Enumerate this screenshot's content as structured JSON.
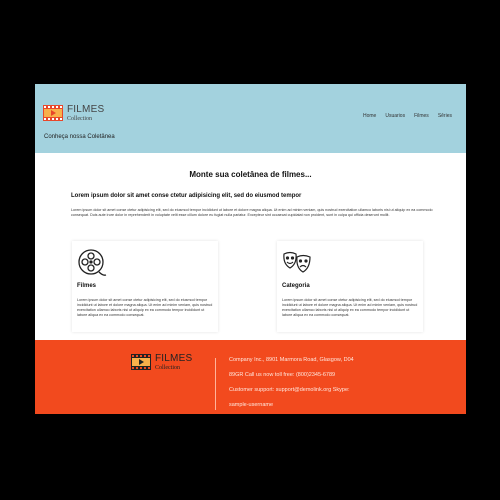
{
  "header": {
    "logo_title": "FILMES",
    "logo_subtitle": "Collection",
    "tagline": "Conheça nossa Coletânea",
    "nav": [
      "Home",
      "Usuarios",
      "Filmes",
      "Sêries"
    ]
  },
  "main": {
    "title": "Monte sua coletânea de filmes...",
    "subtitle": "Lorem ipsum dolor sit amet conse ctetur adipisicing elit, sed do eiusmod tempor",
    "paragraph": "Lorem ipsum dolor sit amet conse ctetur adipisicing elit, sed do eiusmod tempor incididunt ut labore et dolore magna aliqua. Ut enim ad minim veniam, quis nostrud exercitation ullamco laboris nisi ut aliquip ex ea commodo consequat. Duis aute irure dolor in reprehenderit in voluptate velit esse cillum dolore eu fugiat nulla pariatur. Excepteur sint occaecat cupidatat non proident, sunt in culpa qui officia deserunt mollit.",
    "cards": [
      {
        "icon": "film-reel-icon",
        "title": "Filmes",
        "text": "Lorem ipsum dolor sit amet conse ctetur adipisicing elit, sed do eiusmod tempor incididunt ut labore et dolore magna aliqua. Ut enim ad minim veniam, quis nostrud exercitation ullamco laboris nisi ut aliquip ex ea commodo tempor incididunt ut labore aliqua ex ea commodo consequat."
      },
      {
        "icon": "theater-masks-icon",
        "title": "Categoria",
        "text": "Lorem ipsum dolor sit amet conse ctetur adipisicing elit, sed do eiusmod tempor incididunt ut labore et dolore magna aliqua. Ut enim ad minim veniam, quis nostrud exercitation ullamco laboris nisi ut aliquip ex ea commodo tempor incididunt ut labore aliqua ex ea commodo consequat."
      }
    ]
  },
  "footer": {
    "logo_title": "FILMES",
    "logo_subtitle": "Collection",
    "address": "Company Inc., 8901 Marmora Road, Glasgow, D04",
    "phone": "89GR Call us now toll free: (800)2345-6789",
    "support": "Customer support: support@demolink.org Skype:",
    "skype": "sample-username"
  },
  "colors": {
    "header_bg": "#a3d2de",
    "footer_bg": "#f24a1e",
    "logo_accent": "#e8472a"
  }
}
